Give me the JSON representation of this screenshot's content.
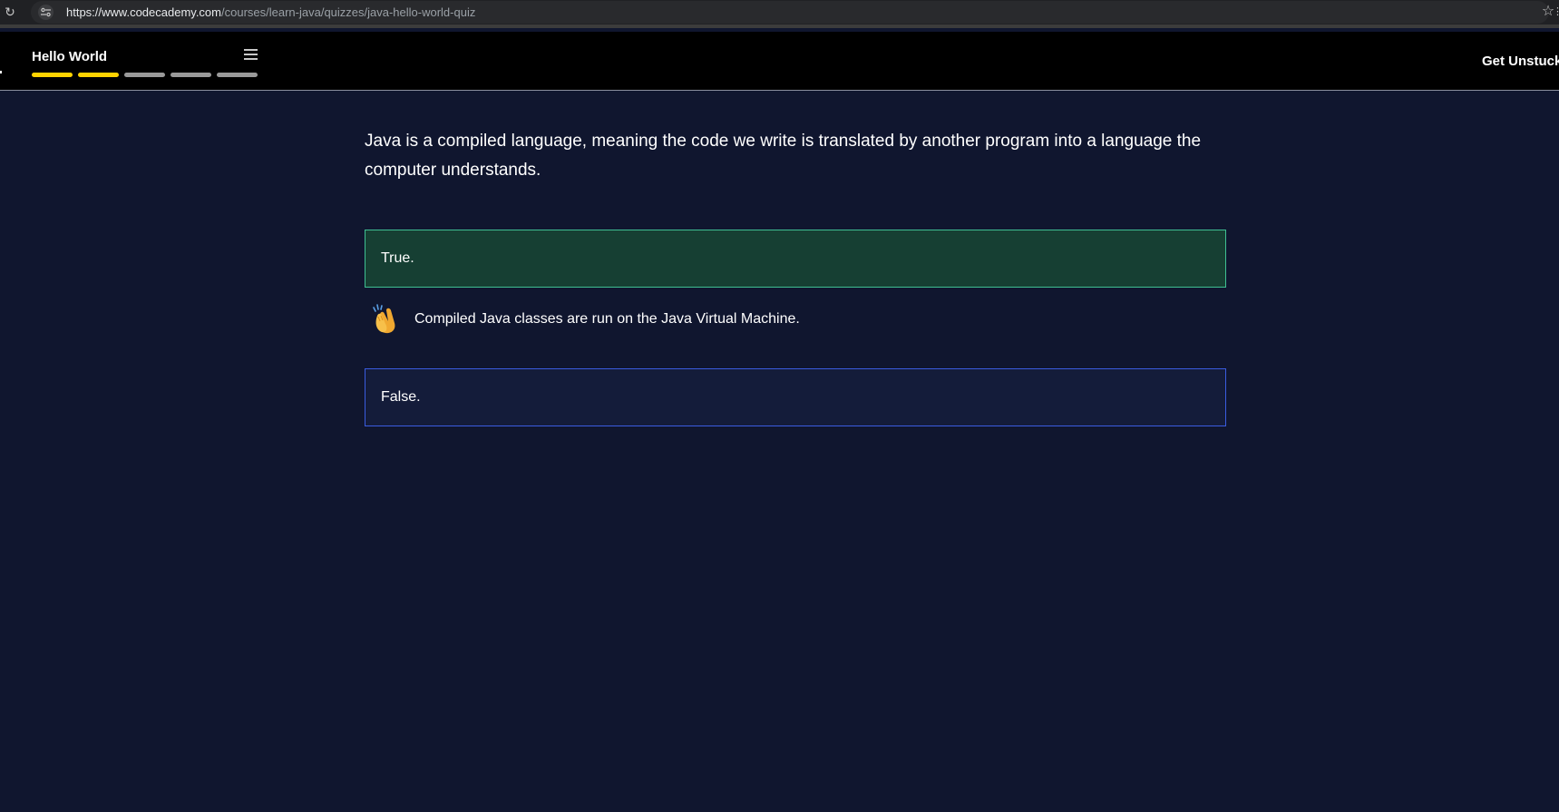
{
  "browser": {
    "url_host": "https://www.codecademy.com",
    "url_path": "/courses/learn-java/quizzes/java-hello-world-quiz"
  },
  "header": {
    "lesson_title": "Hello World",
    "progress": {
      "total_segments": 5,
      "completed_segments": 2,
      "completed_color": "#ffd300",
      "remaining_color": "#9a9a9a"
    },
    "help_label": "Get Unstuck"
  },
  "quiz": {
    "question": "Java is a compiled language, meaning the code we write is translated by another program into a language the computer understands.",
    "answers": [
      {
        "label": "True.",
        "state": "correct-selected"
      },
      {
        "label": "False.",
        "state": "unselected"
      }
    ],
    "feedback": {
      "icon": "clapping-hands-icon",
      "text": "Compiled Java classes are run on the Java Virtual Machine."
    }
  },
  "colors": {
    "page_background": "#10162f",
    "correct_fill": "#163f33",
    "correct_border": "#3fbf93",
    "option_border": "#3a5ce0"
  }
}
